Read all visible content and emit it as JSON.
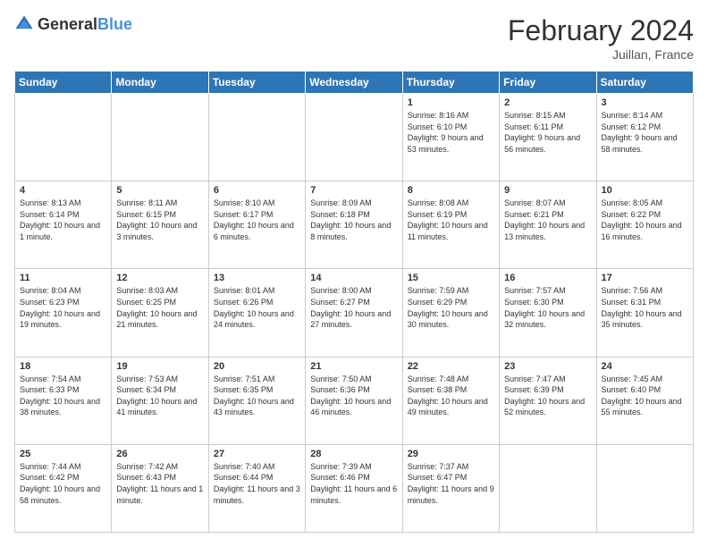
{
  "header": {
    "logo_general": "General",
    "logo_blue": "Blue",
    "month_year": "February 2024",
    "location": "Juillan, France"
  },
  "days": [
    "Sunday",
    "Monday",
    "Tuesday",
    "Wednesday",
    "Thursday",
    "Friday",
    "Saturday"
  ],
  "weeks": [
    [
      {
        "day": "",
        "text": ""
      },
      {
        "day": "",
        "text": ""
      },
      {
        "day": "",
        "text": ""
      },
      {
        "day": "",
        "text": ""
      },
      {
        "day": "1",
        "text": "Sunrise: 8:16 AM\nSunset: 6:10 PM\nDaylight: 9 hours and 53 minutes."
      },
      {
        "day": "2",
        "text": "Sunrise: 8:15 AM\nSunset: 6:11 PM\nDaylight: 9 hours and 56 minutes."
      },
      {
        "day": "3",
        "text": "Sunrise: 8:14 AM\nSunset: 6:12 PM\nDaylight: 9 hours and 58 minutes."
      }
    ],
    [
      {
        "day": "4",
        "text": "Sunrise: 8:13 AM\nSunset: 6:14 PM\nDaylight: 10 hours and 1 minute."
      },
      {
        "day": "5",
        "text": "Sunrise: 8:11 AM\nSunset: 6:15 PM\nDaylight: 10 hours and 3 minutes."
      },
      {
        "day": "6",
        "text": "Sunrise: 8:10 AM\nSunset: 6:17 PM\nDaylight: 10 hours and 6 minutes."
      },
      {
        "day": "7",
        "text": "Sunrise: 8:09 AM\nSunset: 6:18 PM\nDaylight: 10 hours and 8 minutes."
      },
      {
        "day": "8",
        "text": "Sunrise: 8:08 AM\nSunset: 6:19 PM\nDaylight: 10 hours and 11 minutes."
      },
      {
        "day": "9",
        "text": "Sunrise: 8:07 AM\nSunset: 6:21 PM\nDaylight: 10 hours and 13 minutes."
      },
      {
        "day": "10",
        "text": "Sunrise: 8:05 AM\nSunset: 6:22 PM\nDaylight: 10 hours and 16 minutes."
      }
    ],
    [
      {
        "day": "11",
        "text": "Sunrise: 8:04 AM\nSunset: 6:23 PM\nDaylight: 10 hours and 19 minutes."
      },
      {
        "day": "12",
        "text": "Sunrise: 8:03 AM\nSunset: 6:25 PM\nDaylight: 10 hours and 21 minutes."
      },
      {
        "day": "13",
        "text": "Sunrise: 8:01 AM\nSunset: 6:26 PM\nDaylight: 10 hours and 24 minutes."
      },
      {
        "day": "14",
        "text": "Sunrise: 8:00 AM\nSunset: 6:27 PM\nDaylight: 10 hours and 27 minutes."
      },
      {
        "day": "15",
        "text": "Sunrise: 7:59 AM\nSunset: 6:29 PM\nDaylight: 10 hours and 30 minutes."
      },
      {
        "day": "16",
        "text": "Sunrise: 7:57 AM\nSunset: 6:30 PM\nDaylight: 10 hours and 32 minutes."
      },
      {
        "day": "17",
        "text": "Sunrise: 7:56 AM\nSunset: 6:31 PM\nDaylight: 10 hours and 35 minutes."
      }
    ],
    [
      {
        "day": "18",
        "text": "Sunrise: 7:54 AM\nSunset: 6:33 PM\nDaylight: 10 hours and 38 minutes."
      },
      {
        "day": "19",
        "text": "Sunrise: 7:53 AM\nSunset: 6:34 PM\nDaylight: 10 hours and 41 minutes."
      },
      {
        "day": "20",
        "text": "Sunrise: 7:51 AM\nSunset: 6:35 PM\nDaylight: 10 hours and 43 minutes."
      },
      {
        "day": "21",
        "text": "Sunrise: 7:50 AM\nSunset: 6:36 PM\nDaylight: 10 hours and 46 minutes."
      },
      {
        "day": "22",
        "text": "Sunrise: 7:48 AM\nSunset: 6:38 PM\nDaylight: 10 hours and 49 minutes."
      },
      {
        "day": "23",
        "text": "Sunrise: 7:47 AM\nSunset: 6:39 PM\nDaylight: 10 hours and 52 minutes."
      },
      {
        "day": "24",
        "text": "Sunrise: 7:45 AM\nSunset: 6:40 PM\nDaylight: 10 hours and 55 minutes."
      }
    ],
    [
      {
        "day": "25",
        "text": "Sunrise: 7:44 AM\nSunset: 6:42 PM\nDaylight: 10 hours and 58 minutes."
      },
      {
        "day": "26",
        "text": "Sunrise: 7:42 AM\nSunset: 6:43 PM\nDaylight: 11 hours and 1 minute."
      },
      {
        "day": "27",
        "text": "Sunrise: 7:40 AM\nSunset: 6:44 PM\nDaylight: 11 hours and 3 minutes."
      },
      {
        "day": "28",
        "text": "Sunrise: 7:39 AM\nSunset: 6:46 PM\nDaylight: 11 hours and 6 minutes."
      },
      {
        "day": "29",
        "text": "Sunrise: 7:37 AM\nSunset: 6:47 PM\nDaylight: 11 hours and 9 minutes."
      },
      {
        "day": "",
        "text": ""
      },
      {
        "day": "",
        "text": ""
      }
    ]
  ]
}
